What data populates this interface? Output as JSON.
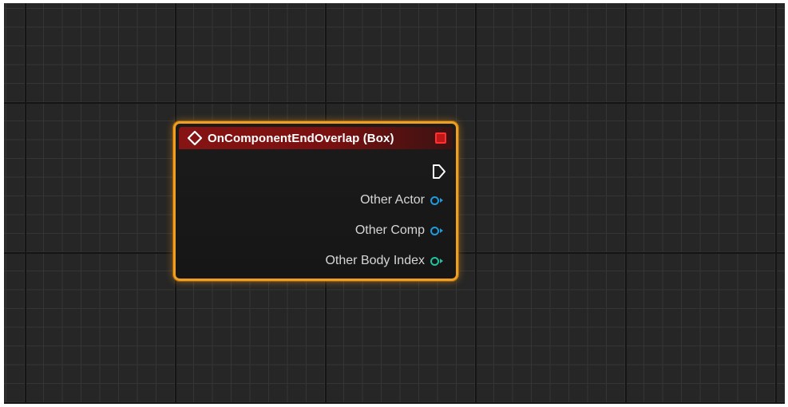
{
  "graph": {
    "background": "#262626"
  },
  "node": {
    "title": "OnComponentEndOverlap (Box)",
    "header_color": "#861414",
    "selection_outline_color": "#f0a020",
    "event_icon": "event-diamond-icon",
    "delegate_pin_icon": "delegate-square-icon",
    "exec_pin_icon": "exec-output-icon",
    "pins": [
      {
        "label": "Other Actor",
        "color": "#1f9be0",
        "icon": "object-pin-icon"
      },
      {
        "label": "Other Comp",
        "color": "#1f9be0",
        "icon": "object-pin-icon"
      },
      {
        "label": "Other Body Index",
        "color": "#1ec3a0",
        "icon": "integer-pin-icon"
      }
    ]
  }
}
